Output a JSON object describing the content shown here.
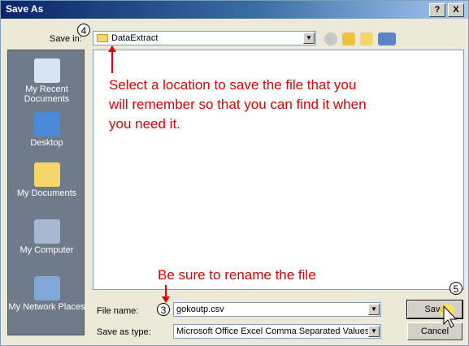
{
  "window": {
    "title": "Save As",
    "help_label": "?",
    "close_label": "X"
  },
  "save_in": {
    "label": "Save in:",
    "value": "DataExtract"
  },
  "places": [
    {
      "label": "My Recent Documents",
      "icon": "recent-documents-icon"
    },
    {
      "label": "Desktop",
      "icon": "desktop-icon"
    },
    {
      "label": "My Documents",
      "icon": "my-documents-icon"
    },
    {
      "label": "My Computer",
      "icon": "my-computer-icon"
    },
    {
      "label": "My Network Places",
      "icon": "network-places-icon"
    }
  ],
  "annotations": {
    "location_note": "Select a location to save the file that you will remember so that you can find it when you need it.",
    "rename_note": "Be sure to rename the file",
    "step4": "4",
    "step3": "3",
    "step5": "5",
    "color": "#e00000"
  },
  "file_name": {
    "label": "File name:",
    "value": "gokoutp.csv"
  },
  "save_as_type": {
    "label": "Save as type:",
    "value": "Microsoft Office Excel Comma Separated Values"
  },
  "buttons": {
    "save": "Save",
    "cancel": "Cancel"
  }
}
